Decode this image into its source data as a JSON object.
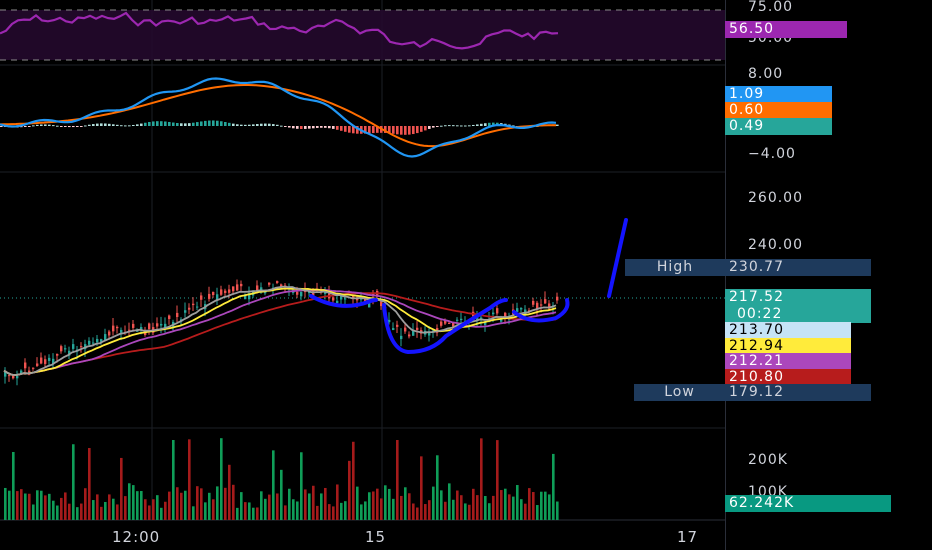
{
  "rsi": {
    "ticks": [
      "75.00",
      "50.00"
    ],
    "value": "56.50",
    "color": "#9c27b0"
  },
  "macd": {
    "ticks": [
      "8.00",
      "−4.00"
    ],
    "badges": [
      {
        "name": "macd-line-value",
        "text": "1.09",
        "color": "#2196f3"
      },
      {
        "name": "signal-line-value",
        "text": "0.60",
        "color": "#ff6d00"
      },
      {
        "name": "histogram-value",
        "text": "0.49",
        "color": "#26a69a"
      }
    ]
  },
  "price": {
    "ticks": [
      "260.00",
      "240.00"
    ],
    "high_label": "High",
    "high_value": "230.77",
    "low_label": "Low",
    "low_value": "179.12",
    "last_price": "217.52",
    "countdown": "00:22",
    "ma_badges": [
      {
        "name": "ma-value-1",
        "text": "213.70",
        "bg": "#c5e3f6",
        "fg": "#000000"
      },
      {
        "name": "ma-value-2",
        "text": "212.94",
        "bg": "#ffeb3b",
        "fg": "#000000"
      },
      {
        "name": "ma-value-3",
        "text": "212.21",
        "bg": "#ab47bc",
        "fg": "#ffffff"
      },
      {
        "name": "ma-value-4",
        "text": "210.80",
        "bg": "#b71c1c",
        "fg": "#ffffff"
      }
    ],
    "colors": {
      "up": "#26a69a",
      "down": "#ef5350",
      "drawing": "#1414ff"
    }
  },
  "volume": {
    "ticks": [
      "200K",
      "100K"
    ],
    "value": "62.242K",
    "color": "#089981"
  },
  "time_axis": [
    "12:00",
    "15",
    "17"
  ]
}
